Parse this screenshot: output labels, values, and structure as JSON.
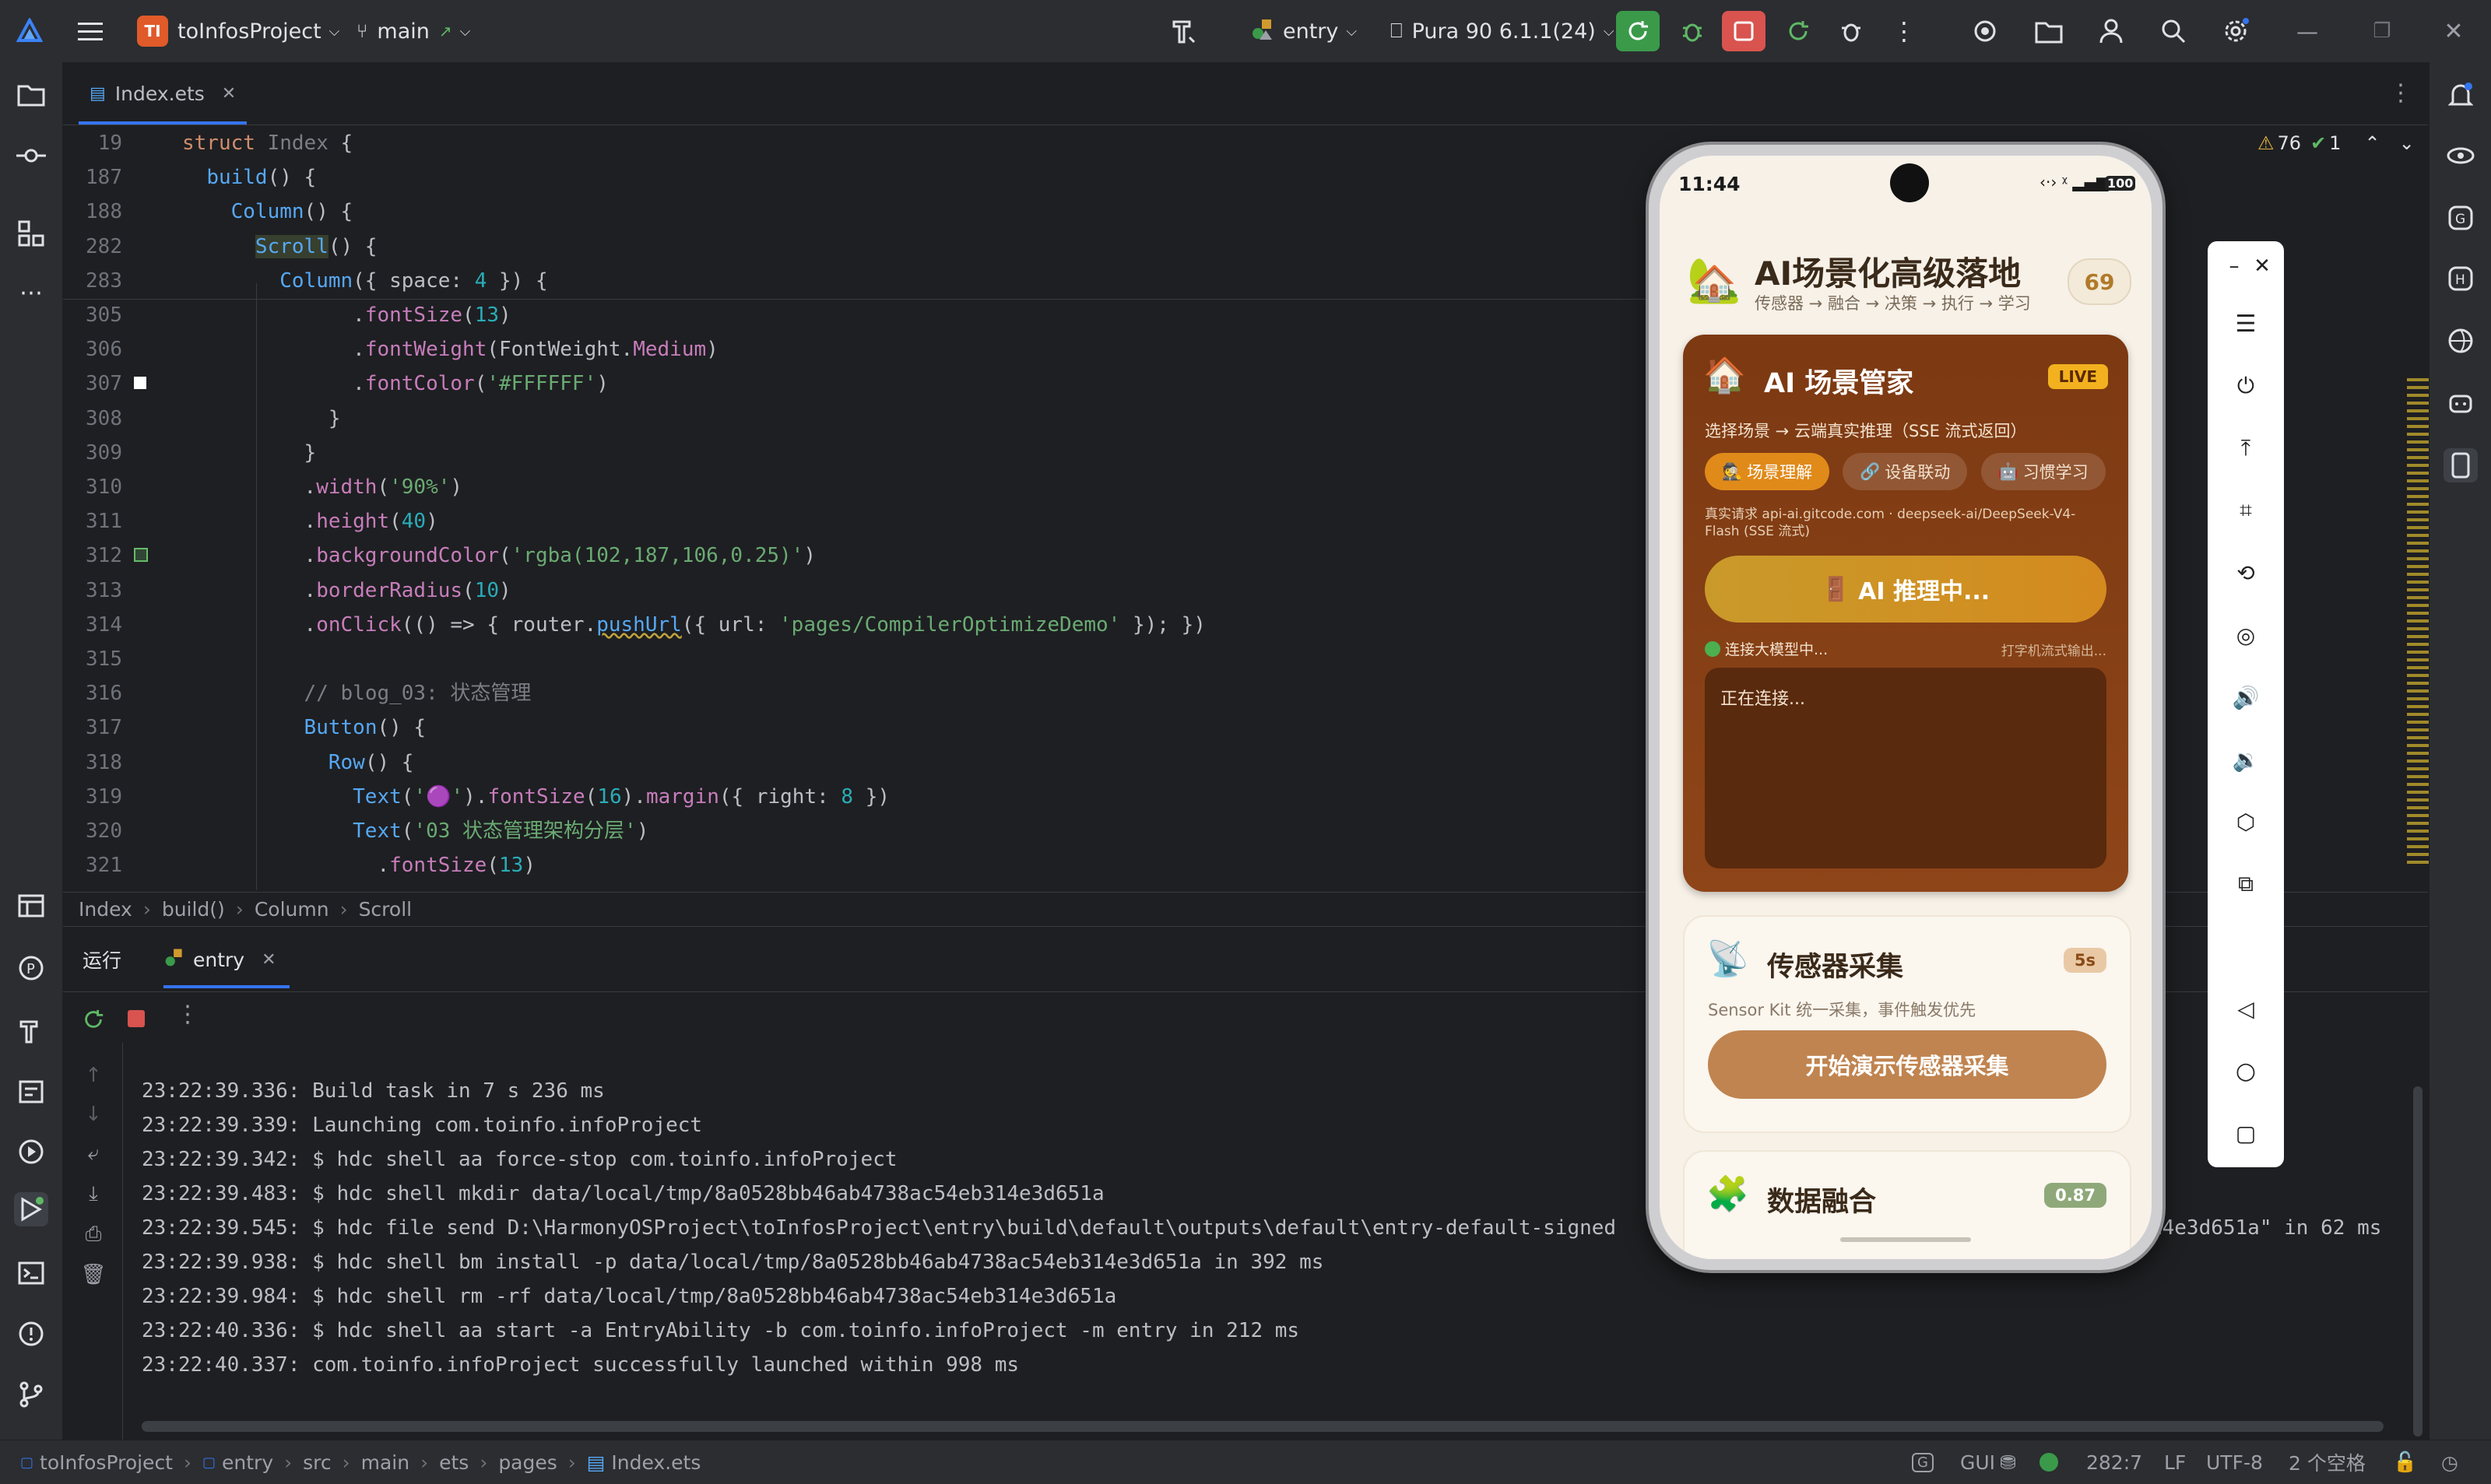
{
  "titlebar": {
    "project_initials": "TI",
    "project_name": "toInfosProject",
    "branch": "main",
    "run_config": "entry",
    "device": "Pura 90 6.1.1(24)"
  },
  "editor": {
    "tab_label": "Index.ets",
    "inspection": {
      "warnings": "76",
      "weak_warnings": "1"
    },
    "lines": [
      {
        "n": "19",
        "html": "<span class='kw'>struct</span> <span class='cmt'>Index</span> {"
      },
      {
        "n": "187",
        "html": "  <span class='fn'>build</span>() {"
      },
      {
        "n": "188",
        "html": "    <span class='fn'>Column</span>() {"
      },
      {
        "n": "282",
        "html": "      <span class='fn' style='background:#373f2e'>Scroll</span>() {"
      },
      {
        "n": "283",
        "html": "        <span class='fn'>Column</span>({ space: <span class='num'>4</span> }) {"
      },
      {
        "n": "305",
        "html": "              .<span class='prop'>fontSize</span>(<span class='num'>13</span>)"
      },
      {
        "n": "306",
        "html": "              .<span class='prop'>fontWeight</span>(FontWeight.<span class='prop'>Medium</span>)"
      },
      {
        "n": "307",
        "html": "              .<span class='prop'>fontColor</span>(<span class='str'>'#FFFFFF'</span>)"
      },
      {
        "n": "308",
        "html": "            }"
      },
      {
        "n": "309",
        "html": "          }"
      },
      {
        "n": "310",
        "html": "          .<span class='prop'>width</span>(<span class='str'>'90%'</span>)"
      },
      {
        "n": "311",
        "html": "          .<span class='prop'>height</span>(<span class='num'>40</span>)"
      },
      {
        "n": "312",
        "html": "          .<span class='prop'>backgroundColor</span>(<span class='str'>'rgba(102,187,106,0.25)'</span>)"
      },
      {
        "n": "313",
        "html": "          .<span class='prop'>borderRadius</span>(<span class='num'>10</span>)"
      },
      {
        "n": "314",
        "html": "          .<span class='prop'>onClick</span>(() =&gt; { router.<span class='fn' style='text-decoration:underline wavy #bfa33b'>pushUrl</span>({ url: <span class='str'>'pages/CompilerOptimizeDemo'</span> }); })"
      },
      {
        "n": "315",
        "html": ""
      },
      {
        "n": "316",
        "html": "          <span class='cmt'>// blog_03: 状态管理</span>"
      },
      {
        "n": "317",
        "html": "          <span class='fn'>Button</span>() {"
      },
      {
        "n": "318",
        "html": "            <span class='fn'>Row</span>() {"
      },
      {
        "n": "319",
        "html": "              <span class='fn'>Text</span>(<span class='str'>'🟣'</span>).<span class='prop'>fontSize</span>(<span class='num'>16</span>).<span class='prop'>margin</span>({ right: <span class='num'>8</span> })"
      },
      {
        "n": "320",
        "html": "              <span class='fn'>Text</span>(<span class='str'>'03 状态管理架构分层'</span>)"
      },
      {
        "n": "321",
        "html": "                .<span class='prop'>fontSize</span>(<span class='num'>13</span>)"
      }
    ],
    "breadcrumb": [
      "Index",
      "build()",
      "Column",
      "Scroll"
    ]
  },
  "run_panel": {
    "title": "运行",
    "tab": "entry",
    "logs": [
      "23:22:39.336: Build task in 7 s 236 ms",
      "23:22:39.339: Launching com.toinfo.infoProject",
      "23:22:39.342: $ hdc shell aa force-stop com.toinfo.infoProject",
      "23:22:39.483: $ hdc shell mkdir data/local/tmp/8a0528bb46ab4738ac54eb314e3d651a",
      "23:22:39.545: $ hdc file send D:\\HarmonyOSProject\\toInfosProject\\entry\\build\\default\\outputs\\default\\entry-default-signed",
      "23:22:39.938: $ hdc shell bm install -p data/local/tmp/8a0528bb46ab4738ac54eb314e3d651a in 392 ms",
      "23:22:39.984: $ hdc shell rm -rf data/local/tmp/8a0528bb46ab4738ac54eb314e3d651a",
      "23:22:40.336: $ hdc shell aa start -a EntryAbility -b com.toinfo.infoProject -m entry in 212 ms",
      "23:22:40.337: com.toinfo.infoProject successfully launched within 998 ms"
    ],
    "log_tail": "eb314e3d651a\" in 62 ms"
  },
  "statusbar": {
    "path": [
      "toInfosProject",
      "entry",
      "src",
      "main",
      "ets",
      "pages",
      "Index.ets"
    ],
    "gui": "GUI",
    "position": "282:7",
    "line_sep": "LF",
    "encoding": "UTF-8",
    "indent": "2 个空格"
  },
  "phone": {
    "time": "11:44",
    "battery": "100",
    "header_title": "AI场景化高级落地",
    "header_sub": "传感器 → 融合 → 决策 → 执行 → 学习",
    "header_score": "69",
    "card1": {
      "title": "AI 场景管家",
      "badge": "LIVE",
      "desc": "选择场景 → 云端真实推理（SSE 流式返回）",
      "chips": [
        "场景理解",
        "设备联动",
        "习惯学习"
      ],
      "api_note": "真实请求 api-ai.gitcode.com · deepseek-ai/DeepSeek-V4-Flash (SSE 流式)",
      "button": "AI 推理中...",
      "status_left": "连接大模型中...",
      "status_right": "打字机流式输出...",
      "output": "正在连接..."
    },
    "card2": {
      "title": "传感器采集",
      "badge": "5s",
      "desc": "Sensor Kit 统一采集，事件触发优先",
      "button": "开始演示传感器采集"
    },
    "card3": {
      "title": "数据融合",
      "badge": "0.87"
    }
  },
  "colors": {
    "accent_blue": "#3574f0",
    "run_green": "#3a9a4a",
    "stop_red": "#d9534f",
    "card_brown": "#7a3a14",
    "btn_gold": "#c98a2e",
    "sensor_btn": "#c08450"
  }
}
